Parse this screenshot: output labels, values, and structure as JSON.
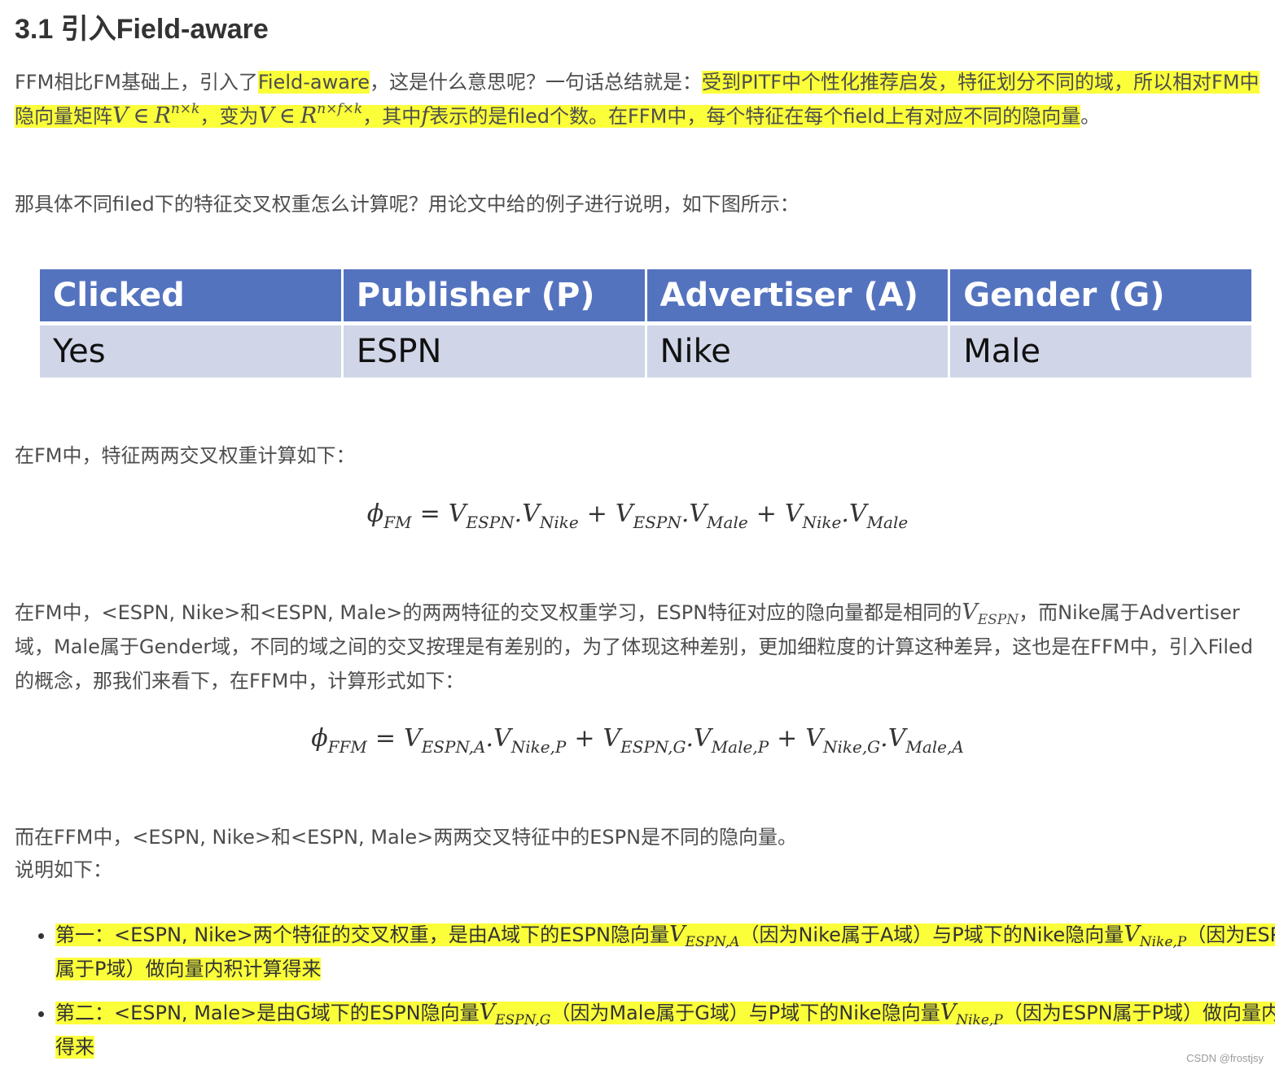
{
  "section_title": "3.1 引入Field-aware",
  "para1": {
    "t1": "FFM相比FM基础上，引入了",
    "h1": "Field-aware",
    "t2": "，这是什么意思呢？一句话总结就是：",
    "h2": "受到PITF中个性化推荐启发，特征划分不同的域，所以相对FM中隐向量矩阵",
    "h3": "，变为",
    "h4": "，其中",
    "h5": "表示的是filed个数。在FFM中，每个特征在每个field上有对应不同的隐向量",
    "t3": "。"
  },
  "math_inline": {
    "V": "V",
    "in": "∈",
    "R": "R",
    "sup1": "n×k",
    "sup2": "n×f×k",
    "f": "f"
  },
  "para2": "那具体不同filed下的特征交叉权重怎么计算呢？用论文中给的例子进行说明，如下图所示：",
  "example_table": {
    "headers": [
      "Clicked",
      "Publisher (P)",
      "Advertiser (A)",
      "Gender (G)"
    ],
    "row": [
      "Yes",
      "ESPN",
      "Nike",
      "Male"
    ]
  },
  "para3": "在FM中，特征两两交叉权重计算如下：",
  "formula_fm": {
    "phi": "ϕ",
    "phi_sub": "FM",
    "eq": "=",
    "t1a": "V",
    "t1a_sub": "ESPN",
    "t1b": "V",
    "t1b_sub": "Nike",
    "plus": "+",
    "t2a": "V",
    "t2a_sub": "ESPN",
    "t2b": "V",
    "t2b_sub": "Male",
    "t3a": "V",
    "t3a_sub": "Nike",
    "t3b": "V",
    "t3b_sub": "Male",
    "dot": "."
  },
  "para4": {
    "t1": "在FM中，<ESPN, Nike>和<ESPN, Male>的两两特征的交叉权重学习，ESPN特征对应的隐向量都是相同的",
    "v": "V",
    "v_sub": "ESPN",
    "t2": "，而Nike属于Advertiser域，Male属于Gender域，不同的域之间的交叉按理是有差别的，为了体现这种差别，更加细粒度的计算这种差异，这也是在FFM中，引入Filed的概念，那我们来看下，在FFM中，计算形式如下："
  },
  "formula_ffm": {
    "phi": "ϕ",
    "phi_sub": "FFM",
    "eq": "=",
    "t1a": "V",
    "t1a_sub": "ESPN,A",
    "t1b": "V",
    "t1b_sub": "Nike,P",
    "plus": "+",
    "t2a": "V",
    "t2a_sub": "ESPN,G",
    "t2b": "V",
    "t2b_sub": "Male,P",
    "t3a": "V",
    "t3a_sub": "Nike,G",
    "t3b": "V",
    "t3b_sub": "Male,A",
    "dot": "."
  },
  "para5": "而在FFM中，<ESPN, Nike>和<ESPN, Male>两两交叉特征中的ESPN是不同的隐向量。",
  "para6": "说明如下：",
  "points": [
    {
      "a": "第一：<ESPN, Nike>两个特征的交叉权重，是由A域下的ESPN隐向量",
      "v1": "V",
      "v1_sub": "ESPN,A",
      "b": "（因为Nike属于A域）与P域下的Nike隐向量",
      "v2": "V",
      "v2_sub": "Nike,P",
      "c": "（因为ESPN属于P域）做向量内积计算得来"
    },
    {
      "a": "第二：<ESPN, Male>是由G域下的ESPN隐向量",
      "v1": "V",
      "v1_sub": "ESPN,G",
      "b": "（因为Male属于G域）与P域下的Nike隐向量",
      "v2": "V",
      "v2_sub": "Nike,P",
      "c": "（因为ESPN属于P域）做向量内积得来"
    }
  ],
  "watermark": "CSDN @frostjsy",
  "colors": {
    "highlight": "#fbff3a",
    "table_header": "#5473bf",
    "table_row": "#d0d6e8"
  }
}
